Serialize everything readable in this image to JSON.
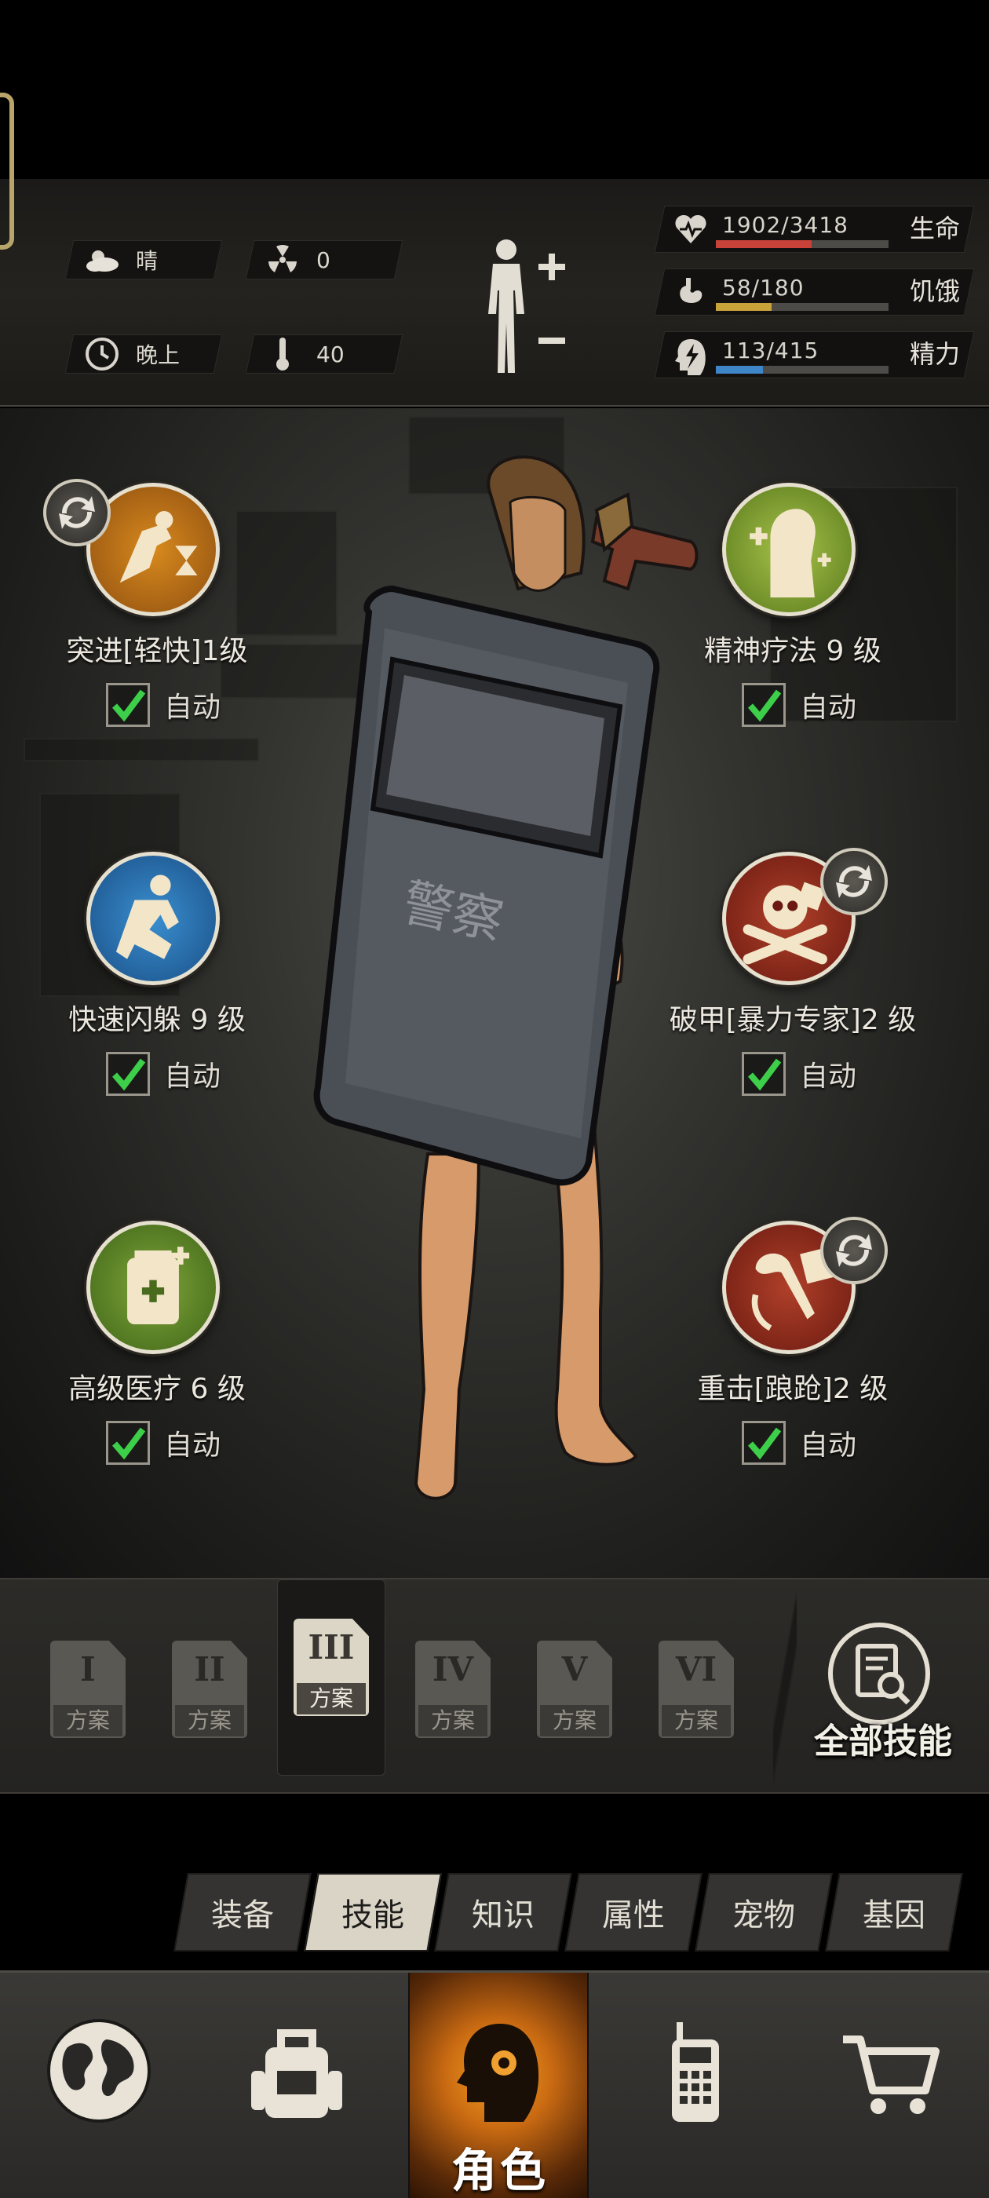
{
  "environment": {
    "weather": "晴",
    "radiation": "0",
    "time_of_day": "晚上",
    "temperature": "40"
  },
  "stats": [
    {
      "label": "生命",
      "value": "1902/3418",
      "fill": 0.556,
      "color": "#c8423a",
      "icon": "heart-pulse-icon"
    },
    {
      "label": "饥饿",
      "value": "58/180",
      "fill": 0.322,
      "color": "#c9a23a",
      "icon": "stomach-icon"
    },
    {
      "label": "精力",
      "value": "113/415",
      "fill": 0.272,
      "color": "#3f86c9",
      "icon": "head-bolt-icon"
    }
  ],
  "skills": {
    "left": [
      {
        "name": "突进[轻快]1级",
        "auto": "自动",
        "icon": "dash-hourglass-icon",
        "swappable": true
      },
      {
        "name": "快速闪躲 9 级",
        "auto": "自动",
        "icon": "dodge-icon",
        "swappable": false
      },
      {
        "name": "高级医疗 6 级",
        "auto": "自动",
        "icon": "medical-kit-icon",
        "swappable": false
      }
    ],
    "right": [
      {
        "name": "精神疗法 9 级",
        "auto": "自动",
        "icon": "mind-therapy-icon",
        "swappable": false
      },
      {
        "name": "破甲[暴力专家]2 级",
        "auto": "自动",
        "icon": "skull-crossbones-icon",
        "swappable": true
      },
      {
        "name": "重击[踉跄]2 级",
        "auto": "自动",
        "icon": "axe-strike-icon",
        "swappable": true
      }
    ]
  },
  "shield_text": "警察",
  "plans": [
    {
      "numeral": "I",
      "label": "方案",
      "active": false
    },
    {
      "numeral": "II",
      "label": "方案",
      "active": false
    },
    {
      "numeral": "III",
      "label": "方案",
      "active": true
    },
    {
      "numeral": "IV",
      "label": "方案",
      "active": false
    },
    {
      "numeral": "V",
      "label": "方案",
      "active": false
    },
    {
      "numeral": "VI",
      "label": "方案",
      "active": false
    }
  ],
  "all_skills_label": "全部技能",
  "sub_tabs": [
    {
      "label": "装备",
      "active": false
    },
    {
      "label": "技能",
      "active": true
    },
    {
      "label": "知识",
      "active": false
    },
    {
      "label": "属性",
      "active": false
    },
    {
      "label": "宠物",
      "active": false
    },
    {
      "label": "基因",
      "active": false
    }
  ],
  "bottom_nav": [
    {
      "label": "",
      "icon": "globe-icon",
      "active": false
    },
    {
      "label": "",
      "icon": "backpack-icon",
      "active": false
    },
    {
      "label": "角色",
      "icon": "character-head-icon",
      "active": true
    },
    {
      "label": "",
      "icon": "radio-icon",
      "active": false
    },
    {
      "label": "",
      "icon": "cart-icon",
      "active": false
    }
  ]
}
